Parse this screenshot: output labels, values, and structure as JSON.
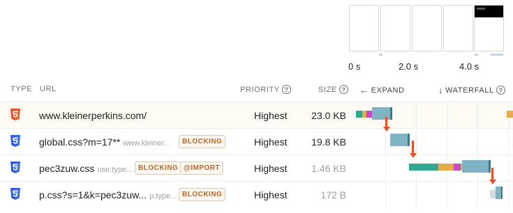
{
  "filmstrip": {
    "time_labels": [
      "0 s",
      "2.0 s",
      "4.0 s"
    ]
  },
  "table": {
    "headers": {
      "type": "TYPE",
      "url": "URL",
      "priority": "PRIORITY",
      "size": "SIZE",
      "expand": "EXPAND",
      "waterfall": "WATERFALL"
    },
    "rows": [
      {
        "type": "html",
        "name": "www.kleinerperkins.com/",
        "host": "",
        "badges": [],
        "priority": "Highest",
        "size": "23.0 KB"
      },
      {
        "type": "css",
        "name": "global.css?m=17**",
        "host": "www.kleiner...",
        "badges": [
          "BLOCKING"
        ],
        "priority": "Highest",
        "size": "19.8 KB"
      },
      {
        "type": "css",
        "name": "pec3zuw.css",
        "host": "use.type...",
        "badges": [
          "BLOCKING",
          "@IMPORT"
        ],
        "priority": "Highest",
        "size": "1.46 KB"
      },
      {
        "type": "css",
        "name": "p.css?s=1&k=pec3zuw...",
        "host": "p.type...",
        "badges": [
          "BLOCKING"
        ],
        "priority": "Highest",
        "size": "172 B"
      }
    ]
  },
  "icons": {
    "help": "question-circle-icon",
    "expand": "arrow-left-icon",
    "waterfall": "arrow-down-icon",
    "html": "html5-icon",
    "css": "css3-icon"
  },
  "colors": {
    "html_icon": "#e44d26",
    "css_icon": "#2f5bd8",
    "badge_text": "#b9682a",
    "render_blocking_arrow": "#e0522b",
    "dns": "#2fa792",
    "connect": "#e4ac4a",
    "ssl": "#c44bc9",
    "wait": "#7fb3c4",
    "download": "#3d7a8c"
  }
}
